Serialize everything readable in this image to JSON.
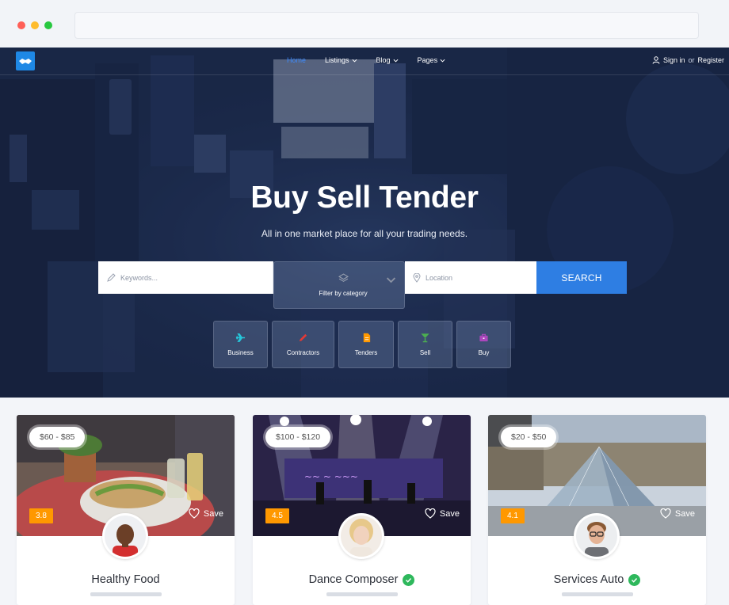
{
  "browser": {
    "url": ""
  },
  "nav": {
    "items": [
      {
        "label": "Home",
        "active": true,
        "dropdown": false
      },
      {
        "label": "Listings",
        "active": false,
        "dropdown": true
      },
      {
        "label": "Blog",
        "active": false,
        "dropdown": true
      },
      {
        "label": "Pages",
        "active": false,
        "dropdown": true
      }
    ],
    "signin": "Sign in",
    "or": "or",
    "register": "Register"
  },
  "hero": {
    "title": "Buy Sell Tender",
    "subtitle": "All in one market place for all your trading needs."
  },
  "search": {
    "keywords_placeholder": "Keywords...",
    "category_placeholder": "Filter by category",
    "location_placeholder": "Location",
    "button": "SEARCH"
  },
  "categories": [
    {
      "label": "Business",
      "icon": "plane-icon",
      "color": "#26c6da"
    },
    {
      "label": "Contractors",
      "icon": "pen-icon",
      "color": "#e53935"
    },
    {
      "label": "Tenders",
      "icon": "document-icon",
      "color": "#ff9800"
    },
    {
      "label": "Sell",
      "icon": "cocktail-icon",
      "color": "#4caf50"
    },
    {
      "label": "Buy",
      "icon": "briefcase-icon",
      "color": "#ab47bc"
    }
  ],
  "listings": [
    {
      "price": "$60 - $85",
      "rating": "3.8",
      "save": "Save",
      "title": "Healthy Food",
      "verified": false
    },
    {
      "price": "$100 - $120",
      "rating": "4.5",
      "save": "Save",
      "title": "Dance Composer",
      "verified": true
    },
    {
      "price": "$20 - $50",
      "rating": "4.1",
      "save": "Save",
      "title": "Services Auto",
      "verified": true
    }
  ],
  "colors": {
    "accent": "#2e7ee3",
    "rating": "#ff9800",
    "verified": "#2eb85c",
    "nav_active": "#3d8bfd"
  }
}
